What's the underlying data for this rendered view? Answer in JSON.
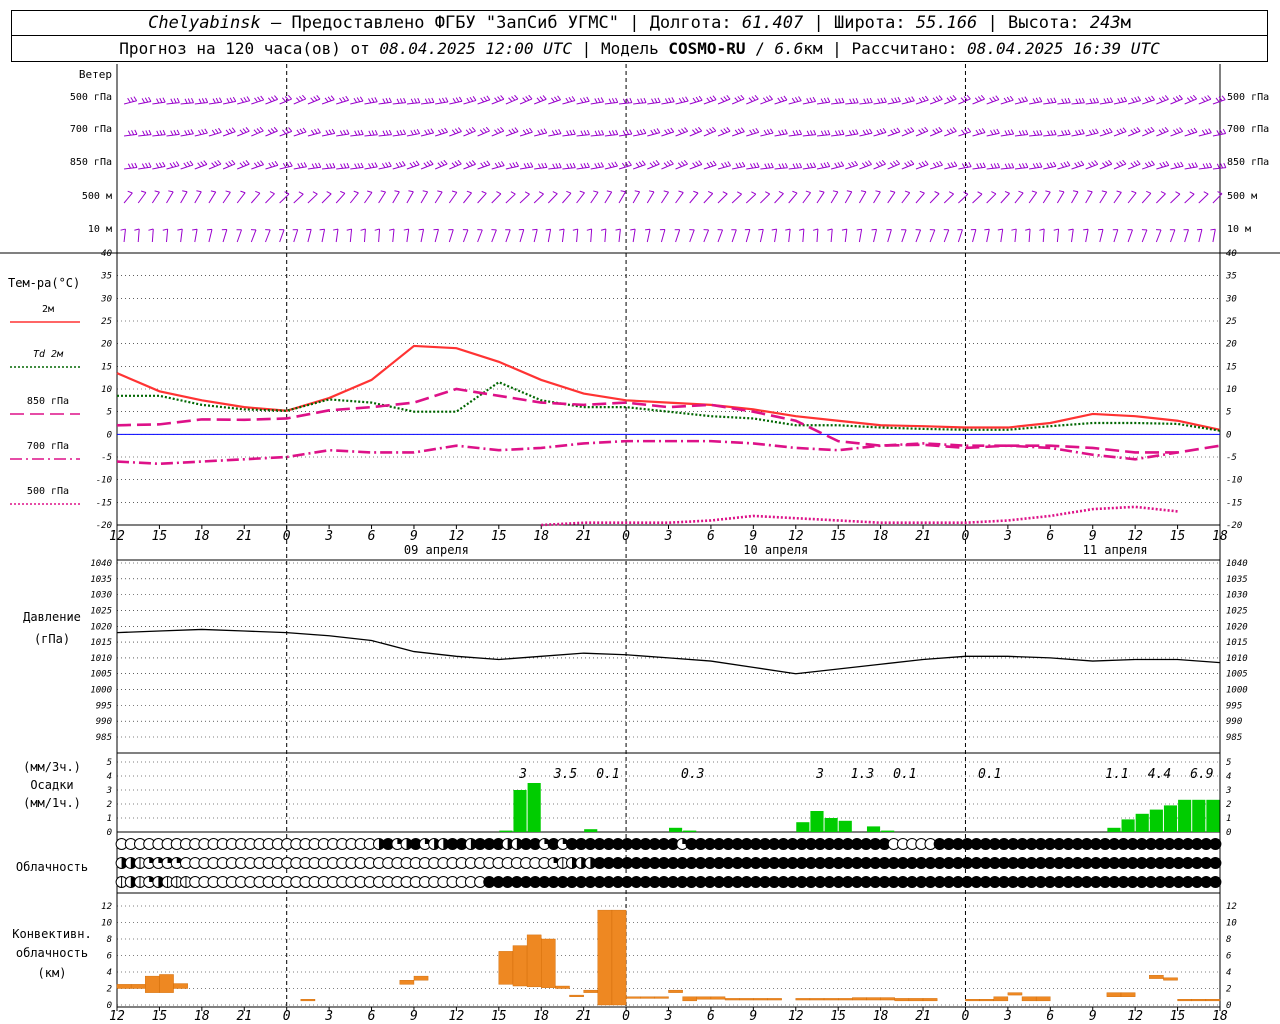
{
  "header": {
    "station": "Chelyabinsk",
    "dash": "–",
    "provided_by": "Предоставлено ФГБУ \"ЗапСиб УГМС\"",
    "lon_label": "Долгота:",
    "lon_value": "61.407",
    "lat_label": "Широта:",
    "lat_value": "55.166",
    "alt_label": "Высота:",
    "alt_value": "243",
    "alt_unit": "м",
    "forecast_prefix": "Прогноз на 120 часа(ов) от",
    "forecast_start": "08.04.2025 12:00 UTC",
    "model_label": "Модель",
    "model_name": "COSMO-RU",
    "model_res": "6.6",
    "model_res_unit": "км",
    "calc_label": "Рассчитано:",
    "calc_time": "08.04.2025 16:39 UTC"
  },
  "chart_data": {
    "hour_ticks": [
      "12",
      "15",
      "18",
      "21",
      "0",
      "3",
      "6",
      "9",
      "12",
      "15",
      "18",
      "21",
      "0",
      "3",
      "6",
      "9",
      "12",
      "15",
      "18",
      "21",
      "0",
      "3",
      "6",
      "9",
      "12",
      "15",
      "18"
    ],
    "day_labels": [
      "09 апреля",
      "10 апреля",
      "11 апреля"
    ],
    "wind": {
      "title": "Ветер",
      "levels_left": [
        "500 гПа",
        "700 гПа",
        "850 гПа",
        "500 м",
        "10 м"
      ],
      "levels_right": [
        "500 гПа",
        "700 гПа",
        "850 гПа",
        "500 м",
        "10 м"
      ],
      "color": "#9900cc"
    },
    "temperature": {
      "type": "line",
      "title": "Тем-ра(°С)",
      "ylim": [
        -20,
        40
      ],
      "yticks": [
        40,
        35,
        30,
        25,
        20,
        15,
        10,
        5,
        0,
        -5,
        -10,
        -15,
        -20
      ],
      "hours": [
        0,
        3,
        6,
        9,
        12,
        15,
        18,
        21,
        24,
        27,
        30,
        33,
        36,
        39,
        42,
        45,
        48,
        51,
        54,
        57,
        60,
        63,
        66,
        69,
        72,
        75,
        78
      ],
      "series": [
        {
          "name": "2м",
          "color": "#ff3333",
          "dash": "solid",
          "values": [
            13.5,
            9.5,
            7.5,
            6,
            5.2,
            8,
            12,
            19.5,
            19,
            16,
            12,
            9,
            7.5,
            7,
            6.5,
            5.5,
            4,
            3,
            2,
            1.8,
            1.5,
            1.5,
            2.5,
            4.5,
            4,
            3,
            1
          ]
        },
        {
          "name": "Td 2м",
          "color": "#006600",
          "dash": "dotted",
          "values": [
            8.5,
            8.5,
            6.5,
            5.5,
            5.2,
            7.7,
            7,
            5,
            5,
            11.5,
            7.5,
            6,
            6,
            5,
            4,
            3.5,
            2,
            2,
            1.5,
            1.2,
            1,
            1,
            1.8,
            2.5,
            2.5,
            2.3,
            0.8
          ]
        },
        {
          "name": "850 гПа",
          "color": "#dd1188",
          "dash": "longdash",
          "values": [
            2,
            2.2,
            3.3,
            3.2,
            3.5,
            5.3,
            6,
            7,
            10,
            8.5,
            7,
            6.5,
            7,
            6,
            6.5,
            5,
            3,
            -1.5,
            -2.5,
            -2.3,
            -3,
            -2.5,
            -2.5,
            -3,
            -4,
            -4,
            -2.5
          ]
        },
        {
          "name": "700 гПа",
          "color": "#dd1188",
          "dash": "dashdot",
          "values": [
            -6,
            -6.5,
            -6,
            -5.5,
            -5,
            -3.5,
            -4,
            -4,
            -2.5,
            -3.5,
            -3,
            -2,
            -1.5,
            -1.5,
            -1.5,
            -2,
            -3,
            -3.5,
            -2.5,
            -2,
            -2.5,
            -2.5,
            -3,
            -4.5,
            -5.5,
            -4
          ]
        },
        {
          "name": "500 гПа",
          "color": "#dd1188",
          "dash": "dotted",
          "values": [
            null,
            null,
            null,
            null,
            null,
            null,
            null,
            null,
            null,
            null,
            -20,
            -19.5,
            -19.5,
            -19.5,
            -19,
            -18,
            -18.5,
            -19,
            -19.5,
            -19.5,
            -19.5,
            -19,
            -18,
            -16.5,
            -16,
            -17
          ]
        }
      ],
      "zero_line_color": "#0000ff"
    },
    "pressure": {
      "type": "line",
      "title": "Давление",
      "unit": "(гПа)",
      "ylim": [
        985,
        1040
      ],
      "yticks": [
        1040,
        1035,
        1030,
        1025,
        1020,
        1015,
        1010,
        1005,
        1000,
        995,
        990,
        985
      ],
      "hours": [
        0,
        3,
        6,
        9,
        12,
        15,
        18,
        21,
        24,
        27,
        30,
        33,
        36,
        39,
        42,
        45,
        48,
        51,
        54,
        57,
        60,
        63,
        66,
        69,
        72,
        75,
        78
      ],
      "values": [
        1018,
        1018.5,
        1019,
        1018.5,
        1018,
        1017,
        1015.5,
        1012,
        1010.5,
        1009.5,
        1010.5,
        1011.5,
        1011,
        1010,
        1009,
        1007,
        1005,
        1006.5,
        1008,
        1009.5,
        1010.5,
        1010.5,
        1010,
        1009,
        1009.5,
        1009.5,
        1008.5
      ],
      "color": "#000000"
    },
    "precip": {
      "type": "bar",
      "title": "Осадки",
      "unit3h": "(мм/3ч.)",
      "unit1h": "(мм/1ч.)",
      "ylim": [
        0,
        5
      ],
      "yticks": [
        5,
        4,
        3,
        2,
        1,
        0
      ],
      "totals": [
        {
          "hour": 29,
          "label": "3"
        },
        {
          "hour": 32,
          "label": "3.5"
        },
        {
          "hour": 35,
          "label": "0.1"
        },
        {
          "hour": 41,
          "label": "0.3"
        },
        {
          "hour": 50,
          "label": "3"
        },
        {
          "hour": 53,
          "label": "1.3"
        },
        {
          "hour": 56,
          "label": "0.1"
        },
        {
          "hour": 62,
          "label": "0.1"
        },
        {
          "hour": 71,
          "label": "1.1"
        },
        {
          "hour": 74,
          "label": "4.4"
        },
        {
          "hour": 77,
          "label": "6.9"
        }
      ],
      "hourly": [
        [
          28,
          0.1
        ],
        [
          29,
          3
        ],
        [
          30,
          3.5
        ],
        [
          34,
          0.2
        ],
        [
          40,
          0.3
        ],
        [
          41,
          0.1
        ],
        [
          49,
          0.7
        ],
        [
          50,
          1.5
        ],
        [
          51,
          1
        ],
        [
          52,
          0.8
        ],
        [
          54,
          0.4
        ],
        [
          55,
          0.1
        ],
        [
          71,
          0.3
        ],
        [
          72,
          0.9
        ],
        [
          73,
          1.3
        ],
        [
          74,
          1.6
        ],
        [
          75,
          1.9
        ],
        [
          76,
          2.3
        ],
        [
          77,
          2.3
        ],
        [
          78,
          2.3
        ]
      ],
      "color": "#00cc00"
    },
    "cloud": {
      "title": "Облачность",
      "rows": [
        "000000000000000000000000000034234233443444334424244444444444424444444444444444444444000004444444444444444444444444444444",
        "331222200000000000000000000000000000000000000002133344444444444444444444444444444444444444444444444444444444444444444444",
        "131231110000000000000000000000000000000044444444444444444444444444444444444444444444444444444444444444444444444444444444"
      ]
    },
    "convective": {
      "type": "bar",
      "title": "Конвективн. облачность (км)",
      "ylim": [
        0,
        13
      ],
      "yticks": [
        12,
        10,
        8,
        6,
        4,
        2,
        0
      ],
      "bars": [
        [
          1,
          2,
          2.5
        ],
        [
          2,
          2,
          2.5
        ],
        [
          3,
          1.5,
          3.5
        ],
        [
          4,
          1.5,
          3.7
        ],
        [
          5,
          2,
          2.6
        ],
        [
          14,
          0.5,
          0.7
        ],
        [
          21,
          2.5,
          3
        ],
        [
          22,
          3,
          3.5
        ],
        [
          28,
          2.5,
          6.5
        ],
        [
          29,
          2.3,
          7.2
        ],
        [
          30,
          2.2,
          8.5
        ],
        [
          31,
          2.1,
          8
        ],
        [
          32,
          2,
          2.3
        ],
        [
          33,
          1,
          1.2
        ],
        [
          34,
          1.5,
          1.8
        ],
        [
          35,
          0,
          11.5
        ],
        [
          36,
          0,
          11.5
        ],
        [
          37,
          0.8,
          1
        ],
        [
          38,
          0.8,
          1
        ],
        [
          39,
          0.8,
          1
        ],
        [
          40,
          1.5,
          1.8
        ],
        [
          41,
          0.5,
          1
        ],
        [
          42,
          0.7,
          1
        ],
        [
          43,
          0.7,
          1
        ],
        [
          44,
          0.6,
          0.8
        ],
        [
          45,
          0.6,
          0.8
        ],
        [
          46,
          0.6,
          0.8
        ],
        [
          47,
          0.6,
          0.8
        ],
        [
          49,
          0.6,
          0.8
        ],
        [
          50,
          0.6,
          0.8
        ],
        [
          51,
          0.6,
          0.8
        ],
        [
          52,
          0.6,
          0.8
        ],
        [
          53,
          0.6,
          0.9
        ],
        [
          54,
          0.6,
          0.9
        ],
        [
          55,
          0.6,
          0.9
        ],
        [
          56,
          0.5,
          0.8
        ],
        [
          57,
          0.5,
          0.8
        ],
        [
          58,
          0.5,
          0.8
        ],
        [
          61,
          0.5,
          0.7
        ],
        [
          62,
          0.5,
          0.7
        ],
        [
          63,
          0.5,
          1
        ],
        [
          64,
          1.2,
          1.5
        ],
        [
          65,
          0.5,
          1
        ],
        [
          66,
          0.5,
          1
        ],
        [
          71,
          1,
          1.5
        ],
        [
          72,
          1,
          1.5
        ],
        [
          74,
          3.2,
          3.6
        ],
        [
          75,
          3,
          3.3
        ],
        [
          76,
          0.5,
          0.7
        ],
        [
          77,
          0.5,
          0.7
        ],
        [
          78,
          0.5,
          0.7
        ]
      ],
      "color": "#ee8822"
    }
  }
}
